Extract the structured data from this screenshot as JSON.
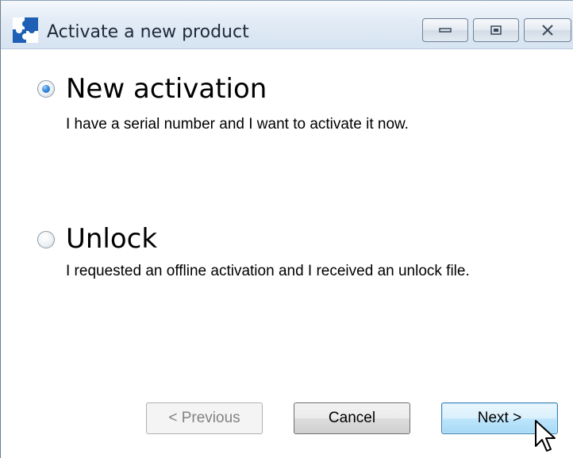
{
  "window": {
    "title": "Activate a new product",
    "icon": "puzzle-piece-icon",
    "caption_buttons": [
      "minimize-icon",
      "restore-icon",
      "close-icon"
    ]
  },
  "options": [
    {
      "title": "New activation",
      "description": "I have a serial number and I want to activate it now.",
      "selected": true
    },
    {
      "title": "Unlock",
      "description": "I requested an offline activation and I received an unlock file.",
      "selected": false
    }
  ],
  "buttons": {
    "previous": "< Previous",
    "cancel": "Cancel",
    "next": "Next >",
    "previous_enabled": false
  },
  "colors": {
    "radio_selected": "#3a8de0",
    "next_button_border": "#3c7fb1"
  }
}
